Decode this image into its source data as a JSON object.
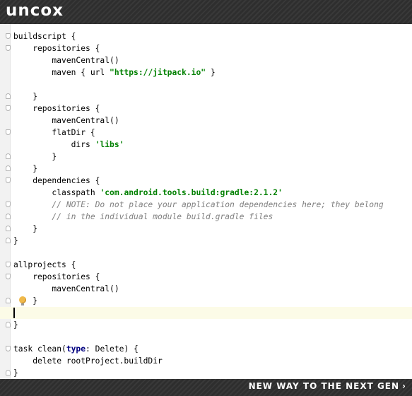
{
  "banner": {
    "logo": "uncox",
    "slogan": "NEW WAY TO THE NEXT GEN",
    "slogan_arrow": "›"
  },
  "editor": {
    "lines": [
      {
        "parts": [
          {
            "t": "buildscript {",
            "c": "plain"
          }
        ],
        "fold": "open"
      },
      {
        "parts": [
          {
            "t": "    repositories {",
            "c": "plain"
          }
        ],
        "fold": "open"
      },
      {
        "parts": [
          {
            "t": "        mavenCentral()",
            "c": "plain"
          }
        ],
        "fold": ""
      },
      {
        "parts": [
          {
            "t": "        maven { url ",
            "c": "plain"
          },
          {
            "t": "\"https://jitpack.io\"",
            "c": "str"
          },
          {
            "t": " }",
            "c": "plain"
          }
        ],
        "fold": ""
      },
      {
        "parts": [
          {
            "t": "",
            "c": "plain"
          }
        ],
        "fold": ""
      },
      {
        "parts": [
          {
            "t": "    }",
            "c": "plain"
          }
        ],
        "fold": "end"
      },
      {
        "parts": [
          {
            "t": "    repositories {",
            "c": "plain"
          }
        ],
        "fold": "open"
      },
      {
        "parts": [
          {
            "t": "        mavenCentral()",
            "c": "plain"
          }
        ],
        "fold": ""
      },
      {
        "parts": [
          {
            "t": "        flatDir {",
            "c": "plain"
          }
        ],
        "fold": "open"
      },
      {
        "parts": [
          {
            "t": "            dirs ",
            "c": "plain"
          },
          {
            "t": "'libs'",
            "c": "str"
          }
        ],
        "fold": ""
      },
      {
        "parts": [
          {
            "t": "        }",
            "c": "plain"
          }
        ],
        "fold": "end"
      },
      {
        "parts": [
          {
            "t": "    }",
            "c": "plain"
          }
        ],
        "fold": "end"
      },
      {
        "parts": [
          {
            "t": "    dependencies {",
            "c": "plain"
          }
        ],
        "fold": "open"
      },
      {
        "parts": [
          {
            "t": "        classpath ",
            "c": "plain"
          },
          {
            "t": "'com.android.tools.build:gradle:2.1.2'",
            "c": "str"
          }
        ],
        "fold": ""
      },
      {
        "parts": [
          {
            "t": "        // NOTE: Do not place your application dependencies here; they belong",
            "c": "cmt"
          }
        ],
        "fold": "open"
      },
      {
        "parts": [
          {
            "t": "        // in the individual module build.gradle files",
            "c": "cmt"
          }
        ],
        "fold": "end"
      },
      {
        "parts": [
          {
            "t": "    }",
            "c": "plain"
          }
        ],
        "fold": "end"
      },
      {
        "parts": [
          {
            "t": "}",
            "c": "plain"
          }
        ],
        "fold": "end"
      },
      {
        "parts": [
          {
            "t": "",
            "c": "plain"
          }
        ],
        "fold": ""
      },
      {
        "parts": [
          {
            "t": "allprojects {",
            "c": "plain"
          }
        ],
        "fold": "open"
      },
      {
        "parts": [
          {
            "t": "    repositories {",
            "c": "plain"
          }
        ],
        "fold": "open"
      },
      {
        "parts": [
          {
            "t": "        mavenCentral()",
            "c": "plain"
          }
        ],
        "fold": ""
      },
      {
        "parts": [
          {
            "t": "    }",
            "c": "plain"
          }
        ],
        "fold": "end",
        "bulb": true
      },
      {
        "parts": [
          {
            "t": "",
            "c": "plain"
          }
        ],
        "fold": "",
        "current": true
      },
      {
        "parts": [
          {
            "t": "}",
            "c": "plain"
          }
        ],
        "fold": "end"
      },
      {
        "parts": [
          {
            "t": "",
            "c": "plain"
          }
        ],
        "fold": ""
      },
      {
        "parts": [
          {
            "t": "task clean(",
            "c": "plain"
          },
          {
            "t": "type",
            "c": "kw"
          },
          {
            "t": ": Delete) {",
            "c": "plain"
          }
        ],
        "fold": "open"
      },
      {
        "parts": [
          {
            "t": "    delete rootProject.buildDir",
            "c": "plain"
          }
        ],
        "fold": ""
      },
      {
        "parts": [
          {
            "t": "}",
            "c": "plain"
          }
        ],
        "fold": "end"
      }
    ]
  }
}
